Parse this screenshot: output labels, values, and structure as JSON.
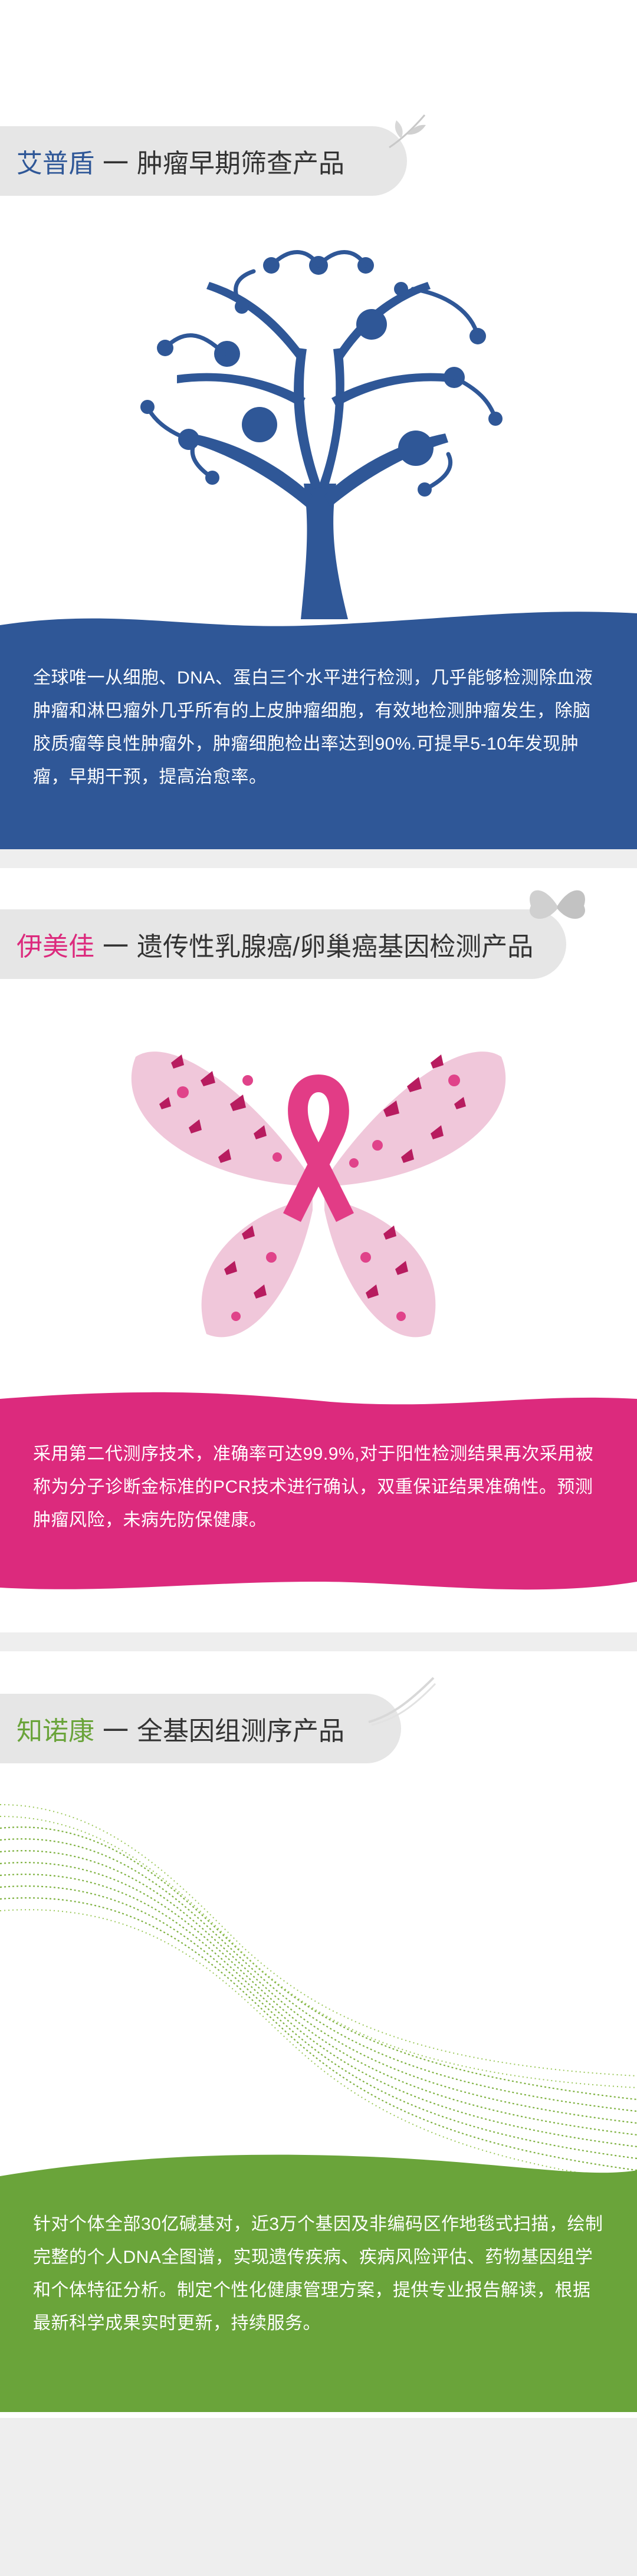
{
  "colors": {
    "blue": "#2f5797",
    "pink": "#dc2a7d",
    "green": "#6aa43a",
    "pill": "#e6e6e6"
  },
  "section1": {
    "brand": "艾普盾",
    "dash": "一",
    "product": "肿瘤早期筛查产品",
    "description": "全球唯一从细胞、DNA、蛋白三个水平进行检测，几乎能够检测除血液肿瘤和淋巴瘤外几乎所有的上皮肿瘤细胞，有效地检测肿瘤发生，除脑胶质瘤等良性肿瘤外，肿瘤细胞检出率达到90%.可提早5-10年发现肿瘤，早期干预，提高治愈率。",
    "icon": "leaf-icon",
    "image": "dna-tree-illustration"
  },
  "section2": {
    "brand": "伊美佳",
    "dash": "一",
    "product": "遗传性乳腺癌/卵巢癌基因检测产品",
    "description": "采用第二代测序技术，准确率可达99.9%,对于阳性检测结果再次采用被称为分子诊断金标准的PCR技术进行确认，双重保证结果准确性。预测肿瘤风险，未病先防保健康。",
    "icon": "butterfly-icon",
    "image": "butterfly-ribbon-illustration"
  },
  "section3": {
    "brand": "知诺康",
    "dash": "一",
    "product": "全基因组测序产品",
    "description": "针对个体全部30亿碱基对，近3万个基因及非编码区作地毯式扫描，绘制完整的个人DNA全图谱，实现遗传疾病、疾病风险评估、药物基因组学和个体特征分析。制定个性化健康管理方案，提供专业报告解读，根据最新科学成果实时更新，持续服务。",
    "icon": "swirl-icon",
    "image": "dna-wave-illustration"
  }
}
